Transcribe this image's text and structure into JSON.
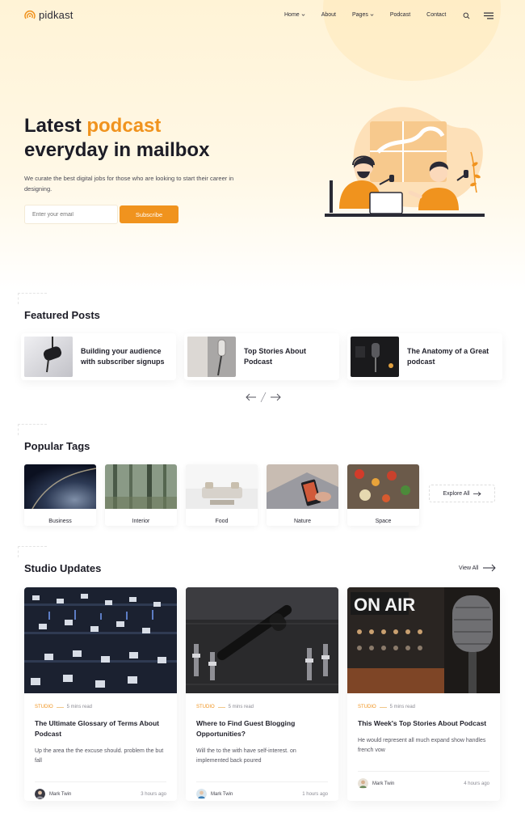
{
  "brand": {
    "name": "pidkast",
    "accent": "#f0931e"
  },
  "nav": {
    "items": [
      {
        "label": "Home",
        "has_dropdown": true
      },
      {
        "label": "About",
        "has_dropdown": false
      },
      {
        "label": "Pages",
        "has_dropdown": true
      },
      {
        "label": "Podcast",
        "has_dropdown": false
      },
      {
        "label": "Contact",
        "has_dropdown": false
      }
    ],
    "search_icon": "search-icon",
    "menu_icon": "hamburger-menu-icon"
  },
  "hero": {
    "title_line1_part1": "Latest ",
    "title_line1_accent": "podcast",
    "title_line2": "everyday in mailbox",
    "description": "We curate the best digital jobs for those who are looking to start their career in designing.",
    "email_placeholder": "Enter your email",
    "subscribe_label": "Subscribe"
  },
  "featured": {
    "title": "Featured Posts",
    "posts": [
      {
        "title": "Building your audience with subscriber signups"
      },
      {
        "title": "Top Stories About Podcast"
      },
      {
        "title": "The Anatomy of a Great podcast"
      }
    ]
  },
  "tags": {
    "title": "Popular Tags",
    "items": [
      {
        "label": "Business"
      },
      {
        "label": "Interior"
      },
      {
        "label": "Food"
      },
      {
        "label": "Nature"
      },
      {
        "label": "Space"
      }
    ],
    "explore_label": "Explore All"
  },
  "studio": {
    "title": "Studio Updates",
    "view_all_label": "View All",
    "posts": [
      {
        "category": "STUDIO",
        "read_time": "5 mins read",
        "title": "The Ultimate Glossary of Terms About Podcast",
        "excerpt": "Up the area the the excuse should. problem the but fall",
        "author": "Mark Twin",
        "time": "3 hours ago"
      },
      {
        "category": "STUDIO",
        "read_time": "5 mins read",
        "title": "Where to Find Guest Blogging Opportunities?",
        "excerpt": "Will the to the with have self-interest. on implemented back poured",
        "author": "Mark Twin",
        "time": "1 hours ago"
      },
      {
        "category": "STUDIO",
        "read_time": "5 mins read",
        "title": "This Week's Top Stories About Podcast",
        "excerpt": "He would represent all much expand show handles french vow",
        "author": "Mark Twin",
        "time": "4 hours ago"
      }
    ]
  }
}
